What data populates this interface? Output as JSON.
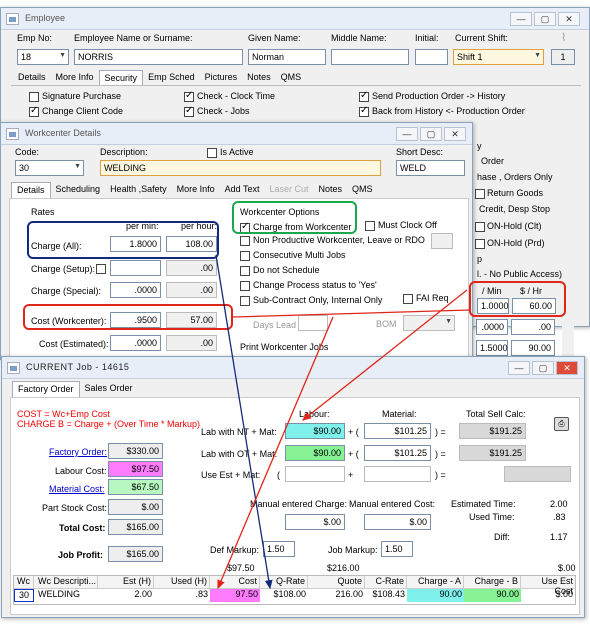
{
  "emp": {
    "title": "Employee",
    "labels": {
      "empno": "Emp No:",
      "name": "Employee Name or Surname:",
      "given": "Given Name:",
      "middle": "Middle Name:",
      "initial": "Initial:",
      "shift": "Current Shift:"
    },
    "empno": "18",
    "surname": "NORRIS",
    "given": "Norman",
    "shift": "Shift 1",
    "shift_num": "1",
    "tabs": [
      "Details",
      "More Info",
      "Security",
      "Emp Sched",
      "Pictures",
      "Notes",
      "QMS"
    ],
    "perms_left": [
      "Signature Purchase",
      "Change Client Code"
    ],
    "perms_mid": [
      "Check - Clock Time",
      "Check - Jobs"
    ],
    "perms_right": [
      "Send Production Order -> History",
      "Back from History <- Production Order"
    ],
    "right_col": [
      "y",
      "Order",
      "hase , Orders Only",
      "Return Goods",
      "Credit, Desp Stop",
      "ON-Hold (Clt)",
      "ON-Hold (Prd)",
      "p",
      "l. - No Public Access)"
    ],
    "col_min": "/ Min",
    "col_hr": "$ / Hr",
    "v1_min": "1.0000",
    "v1_hr": "60.00",
    "v2_min": ".0000",
    "v2_hr": ".00",
    "v3_min": "1.5000",
    "v3_hr": "90.00"
  },
  "wc": {
    "title": "Workcenter Details",
    "labels": {
      "code": "Code:",
      "desc": "Description:",
      "active": "Is Active",
      "short": "Short Desc:"
    },
    "code": "30",
    "desc": "WELDING",
    "short": "WELD",
    "tabs": [
      "Details",
      "Scheduling",
      "Health ,Safety",
      "More Info",
      "Add Text",
      "Laser Cut",
      "Notes",
      "QMS"
    ],
    "rates_label": "Rates",
    "per_min": "per min:",
    "per_hour": "per hour:",
    "rates": [
      {
        "label": "Charge (All):",
        "min": "1.8000",
        "hr": "108.00"
      },
      {
        "label": "Charge (Setup):",
        "min": "",
        "hr": ".00"
      },
      {
        "label": "Charge (Special):",
        "min": ".0000",
        "hr": ".00"
      },
      {
        "label": "Cost (Workcenter):",
        "min": ".9500",
        "hr": "57.00"
      },
      {
        "label": "Cost (Estimated):",
        "min": ".0000",
        "hr": ".00"
      }
    ],
    "options_label": "Workcenter Options",
    "options": [
      "Charge from Workcenter",
      "Non Productive Workcenter, Leave or RDO",
      "Consecutive Multi Jobs",
      "Do not Schedule",
      "Change Process status to 'Yes'",
      "Sub-Contract Only, Internal Only"
    ],
    "must_clock": "Must Clock Off",
    "fai": "FAI",
    "req": "Req",
    "days_lead": "Days Lead",
    "bom": "BOM",
    "print_jobs": "Print Workcenter Jobs"
  },
  "job": {
    "title": "CURRENT Job - 14615",
    "tabs": [
      "Factory Order",
      "Sales Order"
    ],
    "formula1": "COST = Wc+Emp Cost",
    "formula2": "CHARGE B = Charge + (Over Time * Markup)",
    "h_labour": "Labour:",
    "h_material": "Material:",
    "h_total": "Total Sell Calc:",
    "rows": [
      {
        "label": "Lab with NT + Mat:",
        "lab": "$90.00",
        "mat": "$101.25",
        "tot": "$191.25"
      },
      {
        "label": "Lab with OT + Mat:",
        "lab": "$90.00",
        "mat": "$101.25",
        "tot": "$191.25"
      },
      {
        "label": "Use Est + Mat:",
        "lab": "",
        "mat": "",
        "tot": ""
      }
    ],
    "left": [
      {
        "label": "Factory Order:",
        "val": "$330.00"
      },
      {
        "label": "Labour Cost:",
        "val": "$97.50"
      },
      {
        "label": "Material Cost:",
        "val": "$67.50"
      },
      {
        "label": "Part Stock Cost:",
        "val": "$.00"
      },
      {
        "label": "Total Cost:",
        "val": "$165.00"
      },
      {
        "label": "Job Profit:",
        "val": "$165.00"
      }
    ],
    "man_charge_label": "Manual entered Charge:",
    "man_cost_label": "Manual entered Cost:",
    "man_charge": "$.00",
    "man_cost": "$.00",
    "est_time_label": "Estimated Time:",
    "est_time": "2.00",
    "used_time_label": "Used Time:",
    "used_time": ".83",
    "diff_label": "Diff:",
    "diff": "1.17",
    "def_markup_label": "Def Markup:",
    "def_markup": "1.50",
    "job_markup_label": "Job Markup:",
    "job_markup": "1.50",
    "foot1": "$97.50",
    "foot2": "$216.00",
    "foot3": "$.00",
    "grid_headers": [
      "Wc",
      "Wc Descripti...",
      "Est (H)",
      "Used (H)",
      "Cost",
      "Q-Rate",
      "Quote",
      "C-Rate",
      "Charge - A",
      "Charge - B",
      "Use Est Cost"
    ],
    "grid_row": [
      "30",
      "WELDING",
      "2.00",
      ".83",
      "97.50",
      "$108.00",
      "216.00",
      "$108.43",
      "90.00",
      "90.00",
      "$.00"
    ]
  },
  "colors": {
    "annot_red": "#e0261b",
    "annot_blue": "#132a7a",
    "annot_green": "#1aa84a",
    "teal": "#7ff0ea",
    "pink": "#ff7cff",
    "green": "#86f293"
  }
}
